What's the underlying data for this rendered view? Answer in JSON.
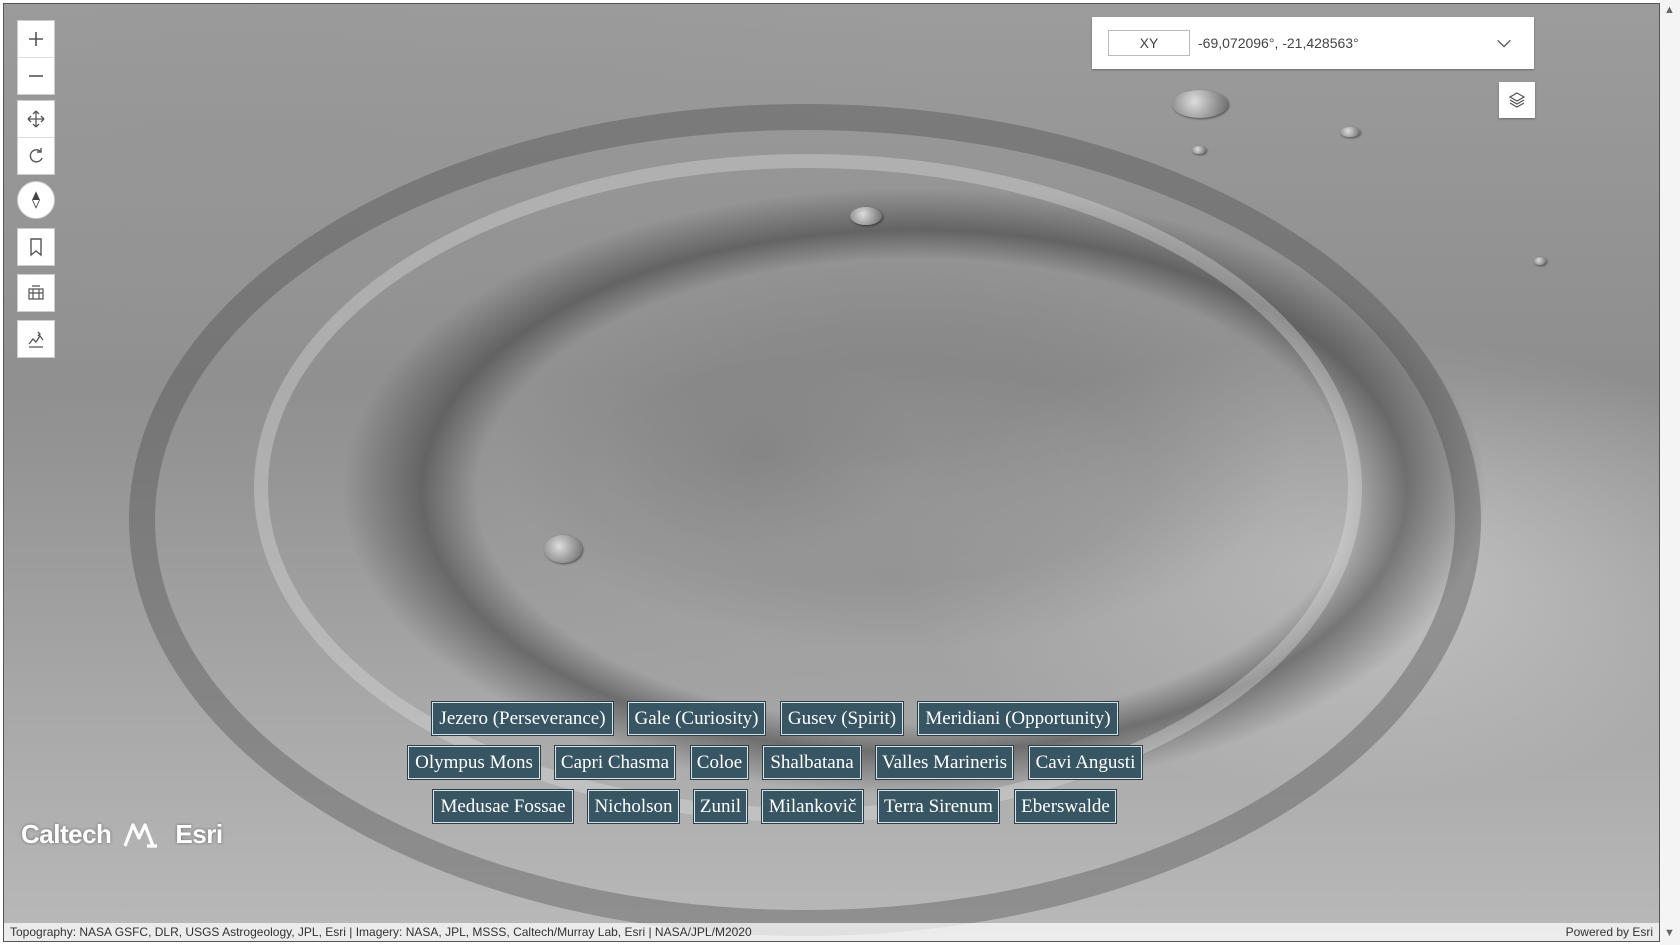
{
  "map": {
    "navigation": {
      "zoom_in_icon": "plus-icon",
      "zoom_out_icon": "minus-icon",
      "pan_icon": "move-icon",
      "rotate_icon": "rotate-icon",
      "compass_icon": "compass-icon",
      "bookmark_icon": "bookmark-icon",
      "daylight_icon": "grid-icon",
      "elevation_icon": "elevation-profile-icon"
    },
    "coordinates": {
      "mode": "XY",
      "value": "-69,072096°, -21,428563°"
    },
    "layers_icon": "layers-icon",
    "bookmarks": [
      [
        "Jezero (Perseverance)",
        "Gale (Curiosity)",
        "Gusev (Spirit)",
        "Meridiani (Opportunity)"
      ],
      [
        "Olympus Mons",
        "Capri Chasma",
        "Coloe",
        "Shalbatana",
        "Valles Marineris",
        "Cavi Angusti"
      ],
      [
        "Medusae Fossae",
        "Nicholson",
        "Zunil",
        "Milankovič",
        "Terra Sirenum",
        "Eberswalde"
      ]
    ],
    "logo": {
      "caltech": "Caltech",
      "esri": "Esri"
    },
    "attribution": {
      "sources": "Topography: NASA GSFC, DLR, USGS Astrogeology, JPL, Esri | Imagery: NASA, JPL, MSSS, Caltech/Murray Lab, Esri | NASA/JPL/M2020",
      "powered_by": "Powered by Esri"
    }
  }
}
